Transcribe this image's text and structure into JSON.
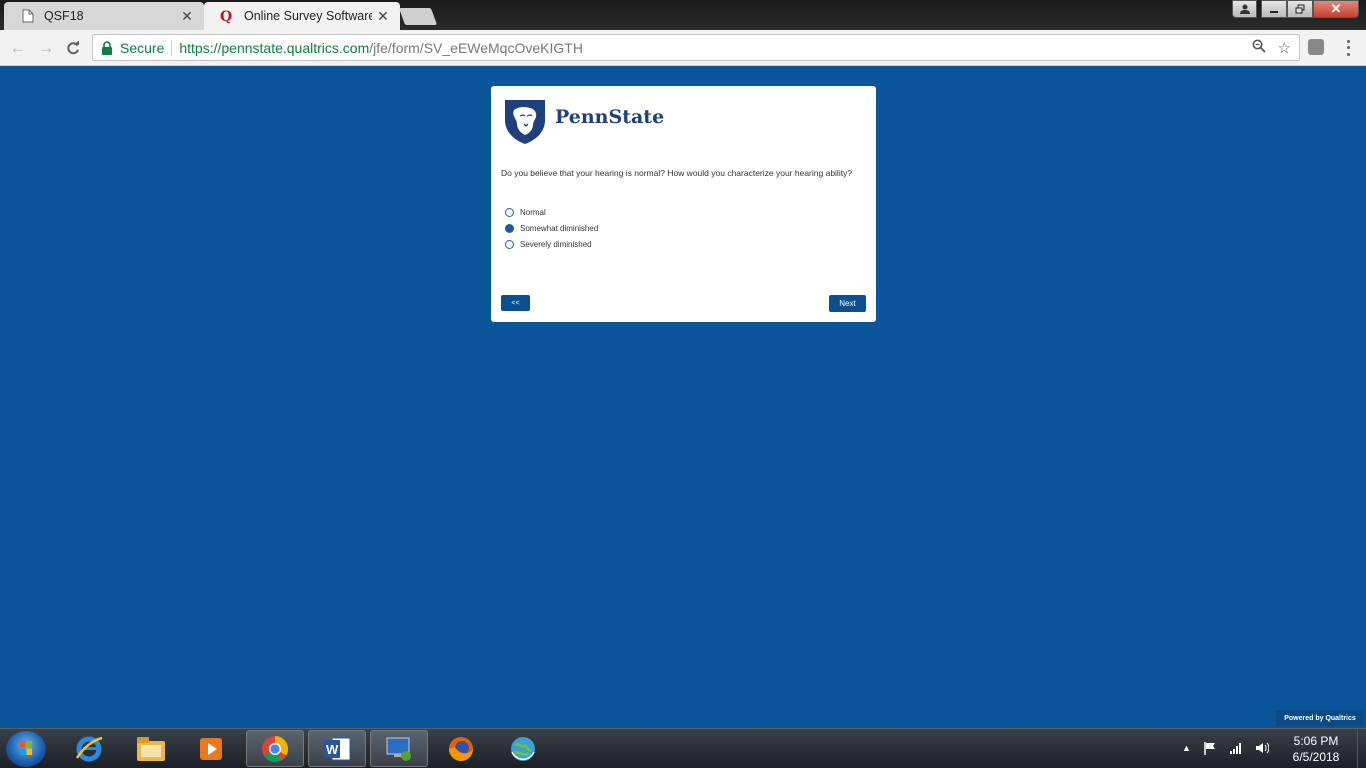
{
  "browser": {
    "tabs": [
      {
        "title": "QSF18",
        "icon": "page-icon"
      },
      {
        "title": "Online Survey Software | Q",
        "icon": "qualtrics-icon"
      }
    ],
    "address": {
      "secure_label": "Secure",
      "url_host": "https://pennstate.qualtrics.com",
      "url_path": "/jfe/form/SV_eEWeMqcOveKIGTH"
    }
  },
  "survey": {
    "logo_text": "PennState",
    "question": "Do you believe that your hearing is normal? How would you characterize your hearing ability?",
    "choices": [
      {
        "label": "Normal",
        "selected": false
      },
      {
        "label": "Somewhat diminished",
        "selected": true
      },
      {
        "label": "Severely diminished",
        "selected": false
      }
    ],
    "back_label": "<<",
    "next_label": "Next"
  },
  "footer": {
    "powered_by": "Powered by Qualtrics"
  },
  "taskbar": {
    "apps": [
      "internet-explorer-icon",
      "file-explorer-icon",
      "media-player-icon",
      "chrome-icon",
      "word-icon",
      "remote-desktop-icon",
      "firefox-icon",
      "globe-app-icon"
    ],
    "time": "5:06 PM",
    "date": "6/5/2018"
  },
  "colors": {
    "page_bg": "#0b559b",
    "button_bg": "#0b4f91",
    "brand": "#1e407c"
  }
}
